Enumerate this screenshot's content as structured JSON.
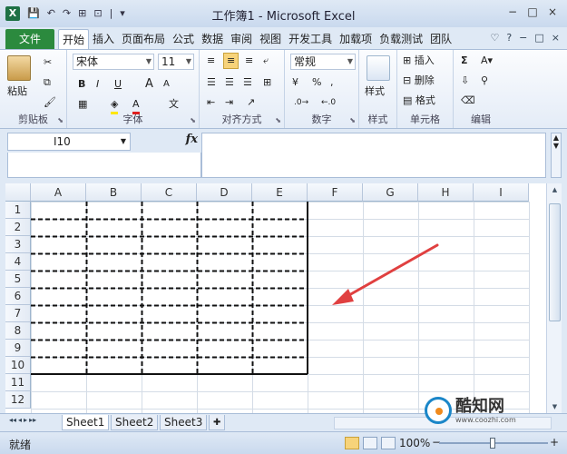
{
  "window": {
    "title": "工作簿1 - Microsoft Excel",
    "logo": "X",
    "controls": [
      "−",
      "□",
      "×"
    ]
  },
  "qat": [
    "💾",
    "↶",
    "·",
    "↷",
    "·",
    "⊞",
    "·",
    "⊡",
    "·",
    "|",
    "▾"
  ],
  "ribbon_tabs": {
    "file": "文件",
    "items": [
      "开始",
      "插入",
      "页面布局",
      "公式",
      "数据",
      "审阅",
      "视图",
      "开发工具",
      "加载项",
      "负载测试",
      "团队"
    ],
    "active": "开始",
    "right": [
      "♡",
      "?",
      "−",
      "□",
      "×"
    ]
  },
  "ribbon": {
    "clipboard": {
      "label": "剪贴板",
      "paste": "粘贴"
    },
    "font": {
      "label": "字体",
      "name": "宋体",
      "size": "11",
      "bold": "B",
      "italic": "I",
      "underline": "U",
      "grow": "A",
      "shrink": "A",
      "phonetic": "文"
    },
    "alignment": {
      "label": "对齐方式"
    },
    "number": {
      "label": "数字",
      "format": "常规",
      "percent": "%",
      "comma": ",",
      "currency": "¥"
    },
    "styles": {
      "label": "样式",
      "big": "样式"
    },
    "cells": {
      "label": "单元格",
      "insert": "插入",
      "delete": "删除",
      "format": "格式"
    },
    "editing": {
      "label": "编辑",
      "sigma": "Σ",
      "sort": "A▾",
      "find": "⚲"
    }
  },
  "formula_bar": {
    "name_box": "I10",
    "fx": "fx",
    "content": ""
  },
  "sheet": {
    "columns": [
      "A",
      "B",
      "C",
      "D",
      "E",
      "F",
      "G",
      "H",
      "I"
    ],
    "rows": [
      "1",
      "2",
      "3",
      "4",
      "5",
      "6",
      "7",
      "8",
      "9",
      "10",
      "11",
      "12"
    ],
    "selected_cell": "I10",
    "bordered_range": "A1:E10"
  },
  "sheet_tabs": {
    "nav": [
      "◂◂",
      "◂",
      "▸",
      "▸▸"
    ],
    "tabs": [
      "Sheet1",
      "Sheet2",
      "Sheet3"
    ],
    "active": "Sheet1"
  },
  "status": {
    "ready": "就绪",
    "zoom": "100%",
    "minus": "−",
    "plus": "+"
  },
  "watermark": {
    "name": "酷知网",
    "url": "www.coozhi.com"
  },
  "colors": {
    "file_tab": "#2b8a3e",
    "arrow": "#e04040",
    "accent": "#1a86c8"
  }
}
